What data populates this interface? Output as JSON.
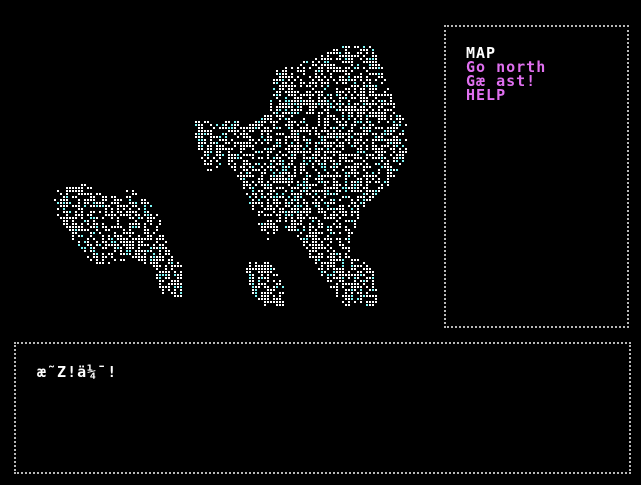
{
  "menu": {
    "items": [
      {
        "label": "MAP",
        "color": "#ffffff"
      },
      {
        "label": "Go north",
        "color": "#e070f0"
      },
      {
        "label": "Gæ ast!",
        "color": "#e070f0"
      },
      {
        "label": "HELP",
        "color": "#e070f0"
      }
    ]
  },
  "message": {
    "text": "æ˜Z!ä¼¯!"
  },
  "colors": {
    "background": "#000000",
    "frame": "#b8b8b8",
    "text_primary": "#ffffff",
    "text_highlight": "#e070f0",
    "dither_cyan": "#7ff6f6"
  }
}
